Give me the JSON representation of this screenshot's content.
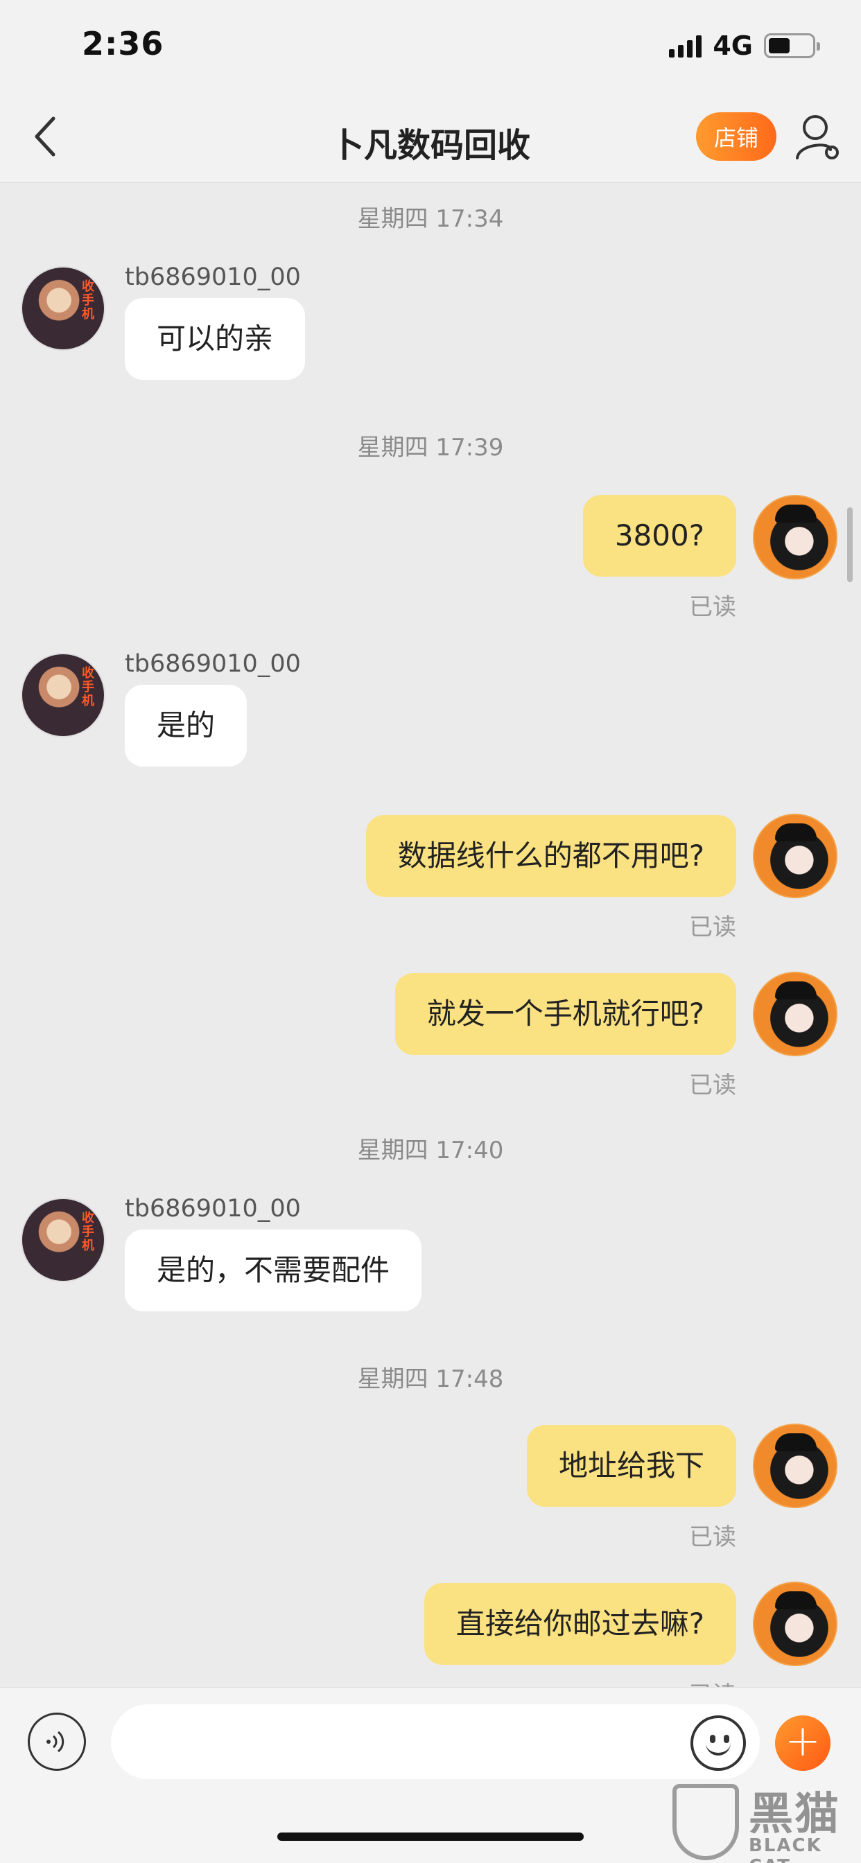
{
  "status_bar": {
    "time": "2:36",
    "network": "4G"
  },
  "nav": {
    "title": "卜凡数码回收",
    "shop_label": "店铺"
  },
  "messages": [
    {
      "type": "time",
      "text": "星期四 17:34"
    },
    {
      "type": "incoming",
      "sender": "tb6869010_00",
      "text": "可以的亲",
      "avatar_text": "收手机"
    },
    {
      "type": "time",
      "text": "星期四 17:39"
    },
    {
      "type": "outgoing",
      "text": "3800?",
      "status": "已读"
    },
    {
      "type": "incoming",
      "sender": "tb6869010_00",
      "text": "是的",
      "avatar_text": "收手机"
    },
    {
      "type": "outgoing",
      "text": "数据线什么的都不用吧?",
      "status": "已读"
    },
    {
      "type": "outgoing",
      "text": "就发一个手机就行吧?",
      "status": "已读"
    },
    {
      "type": "time",
      "text": "星期四 17:40"
    },
    {
      "type": "incoming",
      "sender": "tb6869010_00",
      "text": "是的，不需要配件",
      "avatar_text": "收手机"
    },
    {
      "type": "time",
      "text": "星期四 17:48"
    },
    {
      "type": "outgoing",
      "text": "地址给我下",
      "status": "已读"
    },
    {
      "type": "outgoing",
      "text": "直接给你邮过去嘛?",
      "status": "已读"
    }
  ],
  "input": {
    "value": "",
    "placeholder": ""
  },
  "icons": {
    "back": "chevron-left-icon",
    "profile": "user-settings-icon",
    "voice": "voice-icon",
    "emoji": "smiley-icon",
    "plus": "plus-icon"
  },
  "watermark": {
    "cn": "黑猫",
    "en": "BLACK CAT"
  },
  "colors": {
    "accent": "#ff7a22",
    "outgoing_bubble": "#fae181",
    "incoming_bubble": "#ffffff",
    "background": "#ebebeb"
  }
}
